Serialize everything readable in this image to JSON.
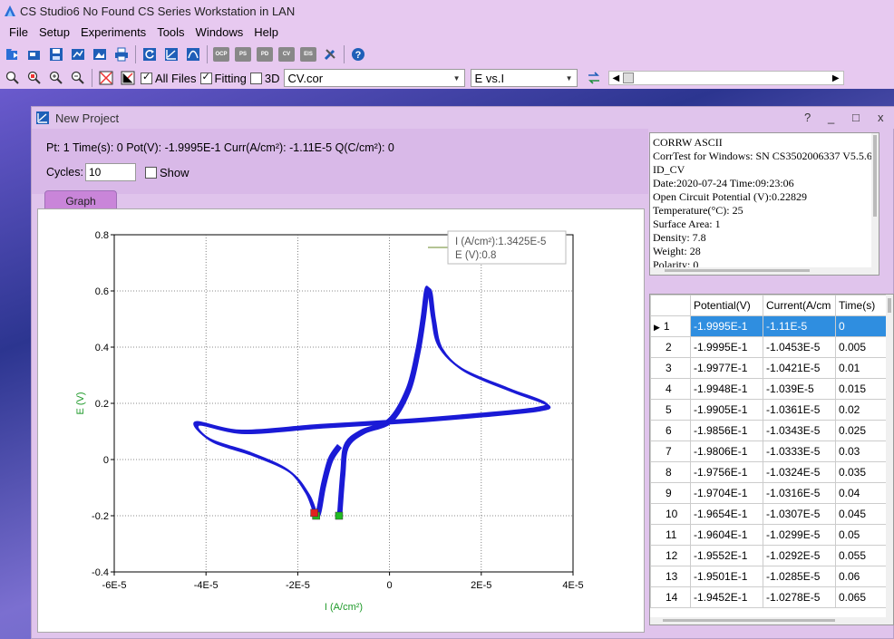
{
  "app": {
    "title": "CS Studio6   No Found CS Series Workstation in LAN"
  },
  "menu": [
    "File",
    "Setup",
    "Experiments",
    "Tools",
    "Windows",
    "Help"
  ],
  "toolbar1": {
    "badges": [
      "OCP",
      "PS",
      "PD",
      "CV",
      "EIS"
    ]
  },
  "toolbar2": {
    "all_files_label": "All Files",
    "all_files_checked": true,
    "fitting_label": "Fitting",
    "fitting_checked": true,
    "threed_label": "3D",
    "threed_checked": false,
    "file_combo": "CV.cor",
    "plot_combo": "E vs.I"
  },
  "project": {
    "title": "New Project",
    "help_btn": "?",
    "minimize_btn": "_",
    "maximize_btn": "□",
    "close_btn": "x",
    "status_line": "Pt:  1  Time(s): 0  Pot(V): -1.9995E-1  Curr(A/cm²): -1.11E-5  Q(C/cm²): 0",
    "cycles_label": "Cycles:",
    "cycles_value": "10",
    "show_label": "Show",
    "show_checked": false,
    "tab_graph": "Graph"
  },
  "tooltip": {
    "line1": "I (A/cm²):1.3425E-5",
    "line2": "E (V):0.8"
  },
  "chart_data": {
    "type": "line",
    "xlabel": "I (A/cm²)",
    "ylabel": "E (V)",
    "xlim": [
      -6e-05,
      4e-05
    ],
    "ylim": [
      -0.4,
      0.8
    ],
    "x_ticks": [
      "-6E-5",
      "-4E-5",
      "-2E-5",
      "0",
      "2E-5",
      "4E-5"
    ],
    "y_ticks": [
      "0.8",
      "0.6",
      "0.4",
      "0.2",
      "0",
      "-0.2",
      "-0.4"
    ],
    "grid": true,
    "series": [
      {
        "color": "#1a1ad6",
        "x": [
          -1.1e-05,
          -1.03e-05,
          -9.5e-06,
          -6e-06,
          0.0,
          4e-06,
          6e-06,
          7.2e-06,
          8e-06,
          8.7e-06,
          9.5e-06,
          1.1e-05,
          1.6e-05,
          2.6e-05,
          3.4e-05,
          3.2e-05,
          2e-05,
          5e-06,
          -1.5e-05,
          -3.2e-05,
          -4.2e-05,
          -3.9e-05,
          -3e-05,
          -2.2e-05,
          -1.8e-05,
          -1.62e-05,
          -1.55e-05,
          -1.45e-05,
          -1.3e-05,
          -1.1e-05
        ],
        "y": [
          -0.2,
          -0.05,
          0.05,
          0.1,
          0.14,
          0.25,
          0.38,
          0.5,
          0.6,
          0.6,
          0.5,
          0.4,
          0.32,
          0.25,
          0.2,
          0.18,
          0.16,
          0.14,
          0.12,
          0.1,
          0.13,
          0.07,
          0.02,
          -0.04,
          -0.12,
          -0.19,
          -0.18,
          -0.09,
          0.0,
          0.05
        ]
      }
    ],
    "markers": [
      {
        "x": -1.6e-05,
        "y": -0.2,
        "color": "#22bb22"
      },
      {
        "x": -1.1e-05,
        "y": -0.2,
        "color": "#22bb22"
      },
      {
        "x": -1.64e-05,
        "y": -0.19,
        "color": "#e02020"
      }
    ],
    "legend_line_color": "#6a8a2a"
  },
  "header_text": [
    "CORRW ASCII",
    "CorrTest for Windows: SN CS3502006337  V5.5.6",
    "ID_CV",
    "Date:2020-07-24   Time:09:23:06",
    "Open Circuit Potential (V):0.22829",
    "Temperature(°C):   25",
    "Surface Area:         1",
    "Density:              7.8",
    "Weight:               28",
    "Polarity:             0"
  ],
  "table": {
    "headers": [
      "",
      "Potential(V)",
      "Current(A/cm",
      "Time(s)"
    ],
    "rows": [
      [
        "1",
        "-1.9995E-1",
        "-1.11E-5",
        "0"
      ],
      [
        "2",
        "-1.9995E-1",
        "-1.0453E-5",
        "0.005"
      ],
      [
        "3",
        "-1.9977E-1",
        "-1.0421E-5",
        "0.01"
      ],
      [
        "4",
        "-1.9948E-1",
        "-1.039E-5",
        "0.015"
      ],
      [
        "5",
        "-1.9905E-1",
        "-1.0361E-5",
        "0.02"
      ],
      [
        "6",
        "-1.9856E-1",
        "-1.0343E-5",
        "0.025"
      ],
      [
        "7",
        "-1.9806E-1",
        "-1.0333E-5",
        "0.03"
      ],
      [
        "8",
        "-1.9756E-1",
        "-1.0324E-5",
        "0.035"
      ],
      [
        "9",
        "-1.9704E-1",
        "-1.0316E-5",
        "0.04"
      ],
      [
        "10",
        "-1.9654E-1",
        "-1.0307E-5",
        "0.045"
      ],
      [
        "11",
        "-1.9604E-1",
        "-1.0299E-5",
        "0.05"
      ],
      [
        "12",
        "-1.9552E-1",
        "-1.0292E-5",
        "0.055"
      ],
      [
        "13",
        "-1.9501E-1",
        "-1.0285E-5",
        "0.06"
      ],
      [
        "14",
        "-1.9452E-1",
        "-1.0278E-5",
        "0.065"
      ]
    ],
    "selected_row": 0
  }
}
